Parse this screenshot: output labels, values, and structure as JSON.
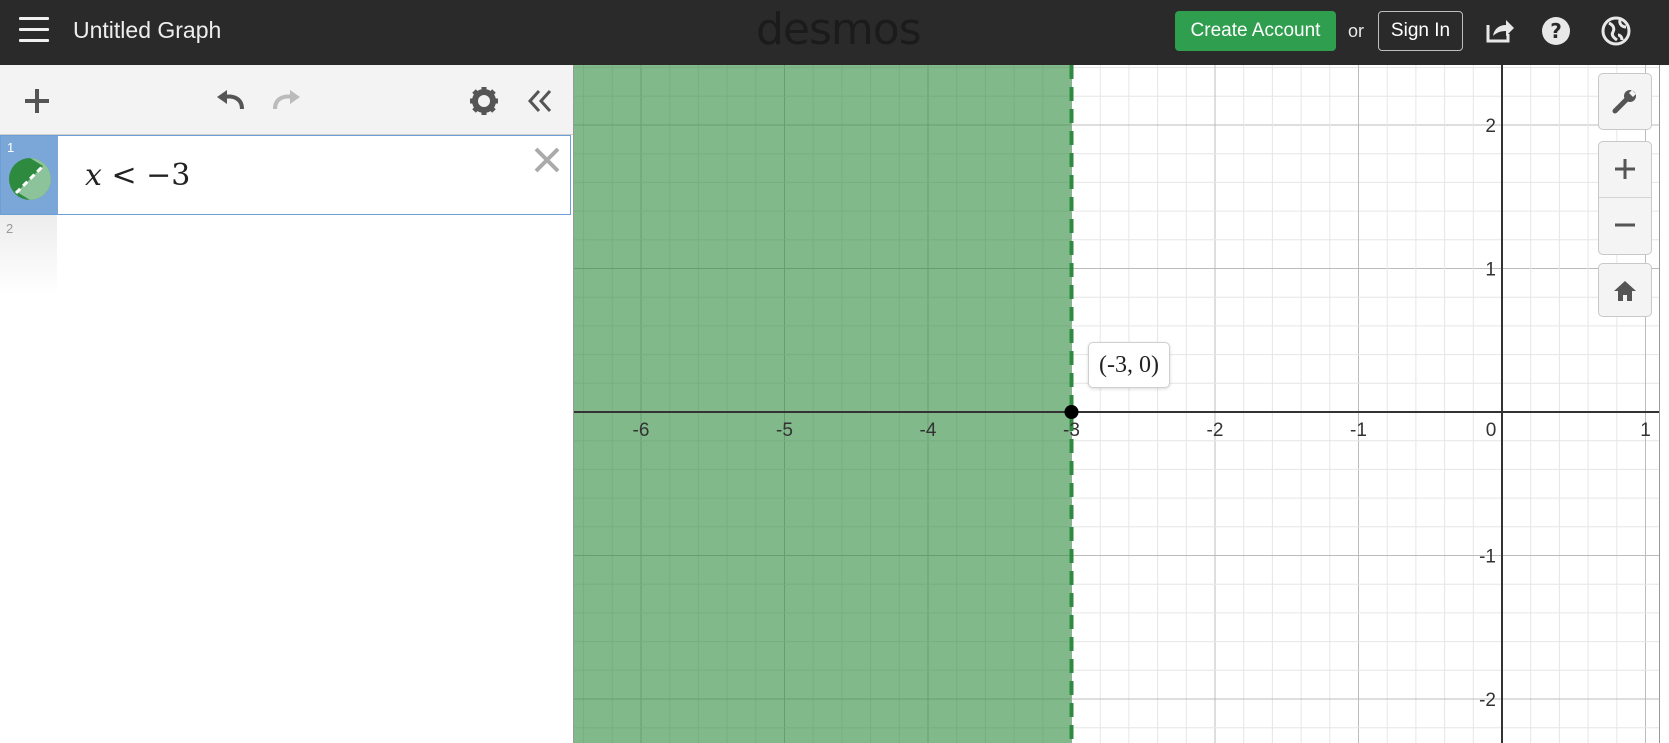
{
  "header": {
    "title": "Untitled Graph",
    "logo": "desmos",
    "create_account_label": "Create Account",
    "or_label": "or",
    "sign_in_label": "Sign In",
    "icons": [
      "share-icon",
      "help-icon",
      "language-globe-icon"
    ]
  },
  "toolbar": {
    "icons": [
      "add-item-icon",
      "undo-icon",
      "redo-icon",
      "settings-gear-icon",
      "collapse-panel-icon"
    ]
  },
  "expressions": [
    {
      "number": "1",
      "latex_var": "x",
      "latex_rest": " < −3",
      "color": "#2d8a3e",
      "style": "dashed"
    },
    {
      "number": "2",
      "latex_var": "",
      "latex_rest": ""
    }
  ],
  "graph": {
    "shaded_region": "x < -3",
    "shade_color": "#2d8a3e",
    "x_ticks": [
      "-6",
      "-5",
      "-4",
      "-3",
      "-2",
      "-1",
      "0",
      "1"
    ],
    "y_ticks": [
      "2",
      "1",
      "-1",
      "-2"
    ],
    "point_label": "(-3, 0)",
    "controls": [
      "wrench-icon",
      "zoom-in-icon",
      "zoom-out-icon",
      "home-icon"
    ]
  }
}
